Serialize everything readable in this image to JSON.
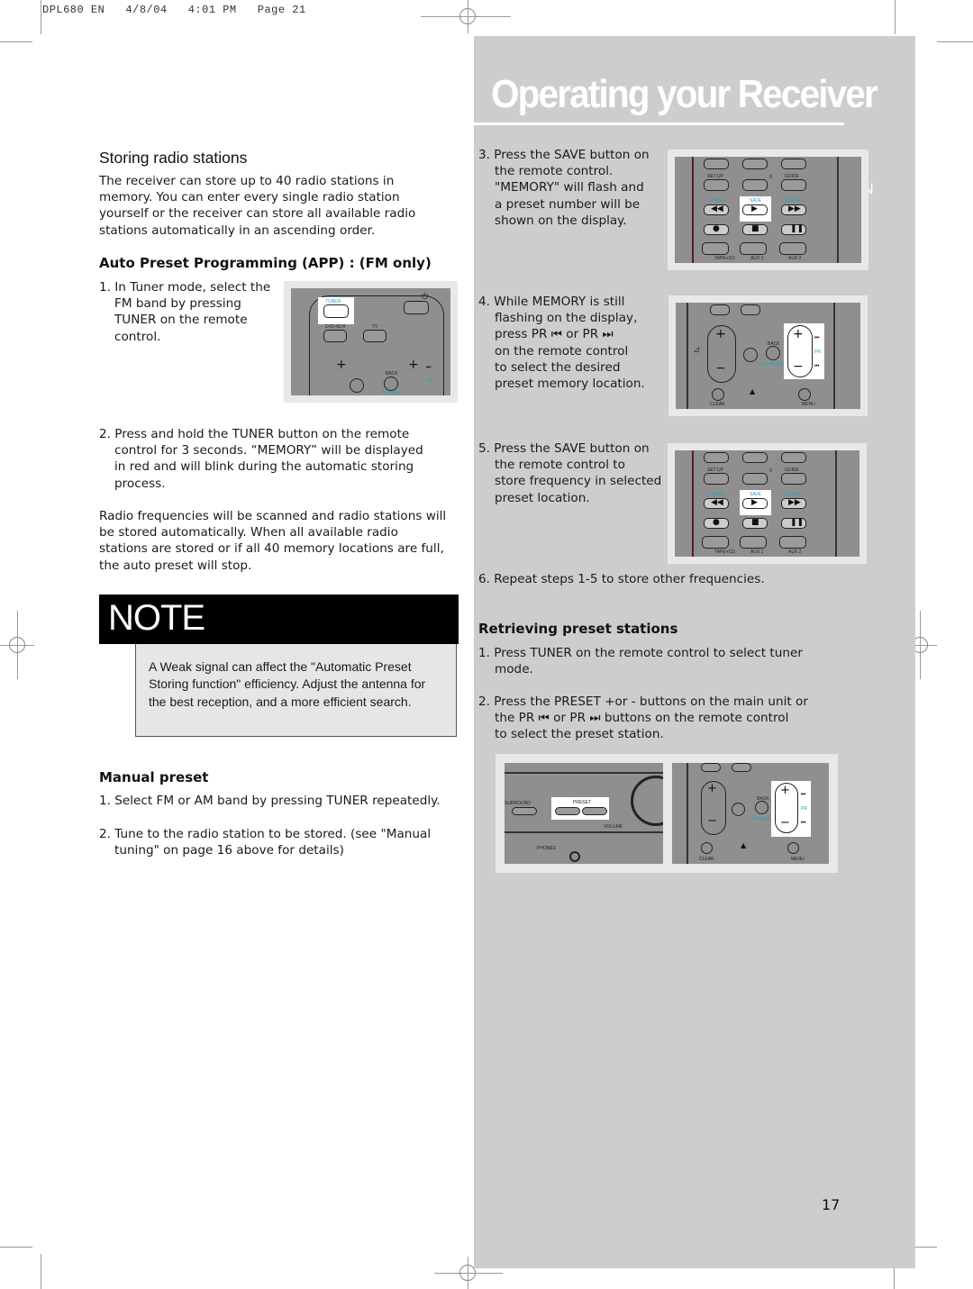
{
  "print_slug": "DPL680 EN   4/8/04   4:01 PM   Page 21",
  "header": {
    "title": "Operating your Receiver",
    "language_tab": "EN"
  },
  "left_column": {
    "storing": {
      "heading": "Storing radio stations",
      "intro": [
        "The receiver can store up to 40 radio stations in",
        "memory. You can enter every single radio station",
        "yourself or the receiver can store all available radio",
        "stations automatically in an ascending order."
      ]
    },
    "app": {
      "heading": "Auto Preset Programming (APP) : (FM only)",
      "step1": [
        "1. In Tuner mode, select the",
        "FM band by pressing",
        "TUNER on the remote",
        "control."
      ],
      "step2": [
        "2. Press and hold the  TUNER button on the remote",
        "control for 3  seconds. “MEMORY” will be displayed",
        "in red and will blink during the automatic storing",
        "process."
      ],
      "paragraph": [
        "Radio frequencies will be scanned and radio stations will",
        "be stored automatically. When all available radio",
        "stations are stored or if all 40 memory locations are full,",
        "the auto preset will stop."
      ]
    },
    "note": {
      "title": "NOTE",
      "text": "A Weak signal can affect the \"Automatic Preset Storing function\" efficiency. Adjust the antenna for the best reception, and a more efficient search."
    },
    "manual": {
      "heading": "Manual preset",
      "step1": "1. Select FM or AM band by pressing TUNER repeatedly.",
      "step2": [
        "2. Tune to the radio station to be stored. (see \"Manual",
        "tuning\" on page 16 above for details)"
      ]
    }
  },
  "right_column": {
    "step3": [
      "3. Press the SAVE button on",
      "the remote control.",
      "\"MEMORY\" will flash and",
      "a preset number will be",
      "shown on the display."
    ],
    "step4": [
      "4. While MEMORY is still",
      "flashing on the display,",
      "press PR ⏮  or PR  ⏭",
      "on the remote control",
      "to select the desired",
      "preset memory location."
    ],
    "step5": [
      "5. Press the SAVE button on",
      "the remote control to",
      "store frequency in selected",
      "preset location."
    ],
    "step6": "6. Repeat steps 1-5 to store other frequencies.",
    "retrieving": {
      "heading": "Retrieving preset stations",
      "step1": [
        "1. Press TUNER on the remote control to select tuner",
        "mode."
      ],
      "step2": [
        "2.  Press the PRESET +or - buttons on the main unit or",
        "the PR ⏮  or PR  ⏭ buttons on the remote control",
        "to select the preset station."
      ]
    }
  },
  "remote_labels": {
    "tuner": "TUNER",
    "dvd6ch": "DVD-6CH",
    "tv": "TV",
    "back": "BACK",
    "st_mono": "ST-MONO",
    "pr": "PR",
    "setup": "SET UP",
    "zero": "0",
    "guide": "GUIDE",
    "tuner_minus": "TUNER –",
    "save": "SAVE",
    "tuner_plus": "TUNER +",
    "tape_cd": "TAPE+CD",
    "aux1": "AUX 1",
    "aux2": "AUX 2",
    "clear": "CLEAR",
    "menu": "MENU",
    "surround": "SURROUND",
    "preset": "PRESET",
    "volume": "VOLUME",
    "phones": "PHONES"
  },
  "page_number": "17"
}
